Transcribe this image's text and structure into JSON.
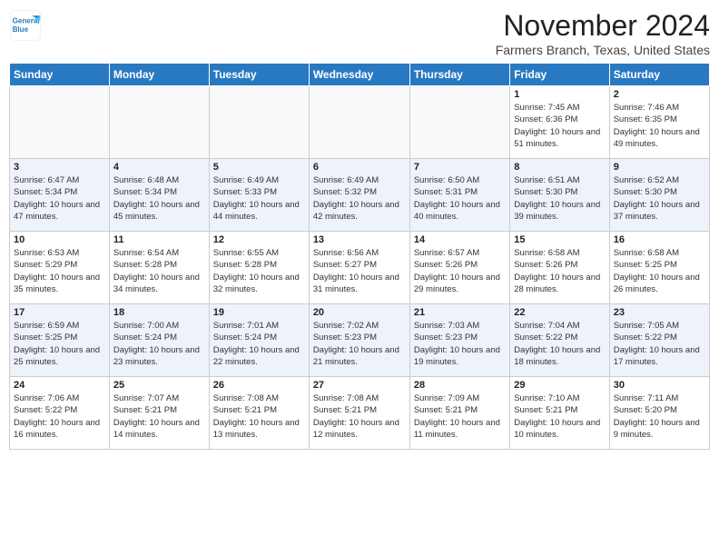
{
  "header": {
    "logo_line1": "General",
    "logo_line2": "Blue",
    "title": "November 2024",
    "subtitle": "Farmers Branch, Texas, United States"
  },
  "days_of_week": [
    "Sunday",
    "Monday",
    "Tuesday",
    "Wednesday",
    "Thursday",
    "Friday",
    "Saturday"
  ],
  "weeks": [
    [
      {
        "num": "",
        "info": ""
      },
      {
        "num": "",
        "info": ""
      },
      {
        "num": "",
        "info": ""
      },
      {
        "num": "",
        "info": ""
      },
      {
        "num": "",
        "info": ""
      },
      {
        "num": "1",
        "info": "Sunrise: 7:45 AM\nSunset: 6:36 PM\nDaylight: 10 hours and 51 minutes."
      },
      {
        "num": "2",
        "info": "Sunrise: 7:46 AM\nSunset: 6:35 PM\nDaylight: 10 hours and 49 minutes."
      }
    ],
    [
      {
        "num": "3",
        "info": "Sunrise: 6:47 AM\nSunset: 5:34 PM\nDaylight: 10 hours and 47 minutes."
      },
      {
        "num": "4",
        "info": "Sunrise: 6:48 AM\nSunset: 5:34 PM\nDaylight: 10 hours and 45 minutes."
      },
      {
        "num": "5",
        "info": "Sunrise: 6:49 AM\nSunset: 5:33 PM\nDaylight: 10 hours and 44 minutes."
      },
      {
        "num": "6",
        "info": "Sunrise: 6:49 AM\nSunset: 5:32 PM\nDaylight: 10 hours and 42 minutes."
      },
      {
        "num": "7",
        "info": "Sunrise: 6:50 AM\nSunset: 5:31 PM\nDaylight: 10 hours and 40 minutes."
      },
      {
        "num": "8",
        "info": "Sunrise: 6:51 AM\nSunset: 5:30 PM\nDaylight: 10 hours and 39 minutes."
      },
      {
        "num": "9",
        "info": "Sunrise: 6:52 AM\nSunset: 5:30 PM\nDaylight: 10 hours and 37 minutes."
      }
    ],
    [
      {
        "num": "10",
        "info": "Sunrise: 6:53 AM\nSunset: 5:29 PM\nDaylight: 10 hours and 35 minutes."
      },
      {
        "num": "11",
        "info": "Sunrise: 6:54 AM\nSunset: 5:28 PM\nDaylight: 10 hours and 34 minutes."
      },
      {
        "num": "12",
        "info": "Sunrise: 6:55 AM\nSunset: 5:28 PM\nDaylight: 10 hours and 32 minutes."
      },
      {
        "num": "13",
        "info": "Sunrise: 6:56 AM\nSunset: 5:27 PM\nDaylight: 10 hours and 31 minutes."
      },
      {
        "num": "14",
        "info": "Sunrise: 6:57 AM\nSunset: 5:26 PM\nDaylight: 10 hours and 29 minutes."
      },
      {
        "num": "15",
        "info": "Sunrise: 6:58 AM\nSunset: 5:26 PM\nDaylight: 10 hours and 28 minutes."
      },
      {
        "num": "16",
        "info": "Sunrise: 6:58 AM\nSunset: 5:25 PM\nDaylight: 10 hours and 26 minutes."
      }
    ],
    [
      {
        "num": "17",
        "info": "Sunrise: 6:59 AM\nSunset: 5:25 PM\nDaylight: 10 hours and 25 minutes."
      },
      {
        "num": "18",
        "info": "Sunrise: 7:00 AM\nSunset: 5:24 PM\nDaylight: 10 hours and 23 minutes."
      },
      {
        "num": "19",
        "info": "Sunrise: 7:01 AM\nSunset: 5:24 PM\nDaylight: 10 hours and 22 minutes."
      },
      {
        "num": "20",
        "info": "Sunrise: 7:02 AM\nSunset: 5:23 PM\nDaylight: 10 hours and 21 minutes."
      },
      {
        "num": "21",
        "info": "Sunrise: 7:03 AM\nSunset: 5:23 PM\nDaylight: 10 hours and 19 minutes."
      },
      {
        "num": "22",
        "info": "Sunrise: 7:04 AM\nSunset: 5:22 PM\nDaylight: 10 hours and 18 minutes."
      },
      {
        "num": "23",
        "info": "Sunrise: 7:05 AM\nSunset: 5:22 PM\nDaylight: 10 hours and 17 minutes."
      }
    ],
    [
      {
        "num": "24",
        "info": "Sunrise: 7:06 AM\nSunset: 5:22 PM\nDaylight: 10 hours and 16 minutes."
      },
      {
        "num": "25",
        "info": "Sunrise: 7:07 AM\nSunset: 5:21 PM\nDaylight: 10 hours and 14 minutes."
      },
      {
        "num": "26",
        "info": "Sunrise: 7:08 AM\nSunset: 5:21 PM\nDaylight: 10 hours and 13 minutes."
      },
      {
        "num": "27",
        "info": "Sunrise: 7:08 AM\nSunset: 5:21 PM\nDaylight: 10 hours and 12 minutes."
      },
      {
        "num": "28",
        "info": "Sunrise: 7:09 AM\nSunset: 5:21 PM\nDaylight: 10 hours and 11 minutes."
      },
      {
        "num": "29",
        "info": "Sunrise: 7:10 AM\nSunset: 5:21 PM\nDaylight: 10 hours and 10 minutes."
      },
      {
        "num": "30",
        "info": "Sunrise: 7:11 AM\nSunset: 5:20 PM\nDaylight: 10 hours and 9 minutes."
      }
    ]
  ]
}
